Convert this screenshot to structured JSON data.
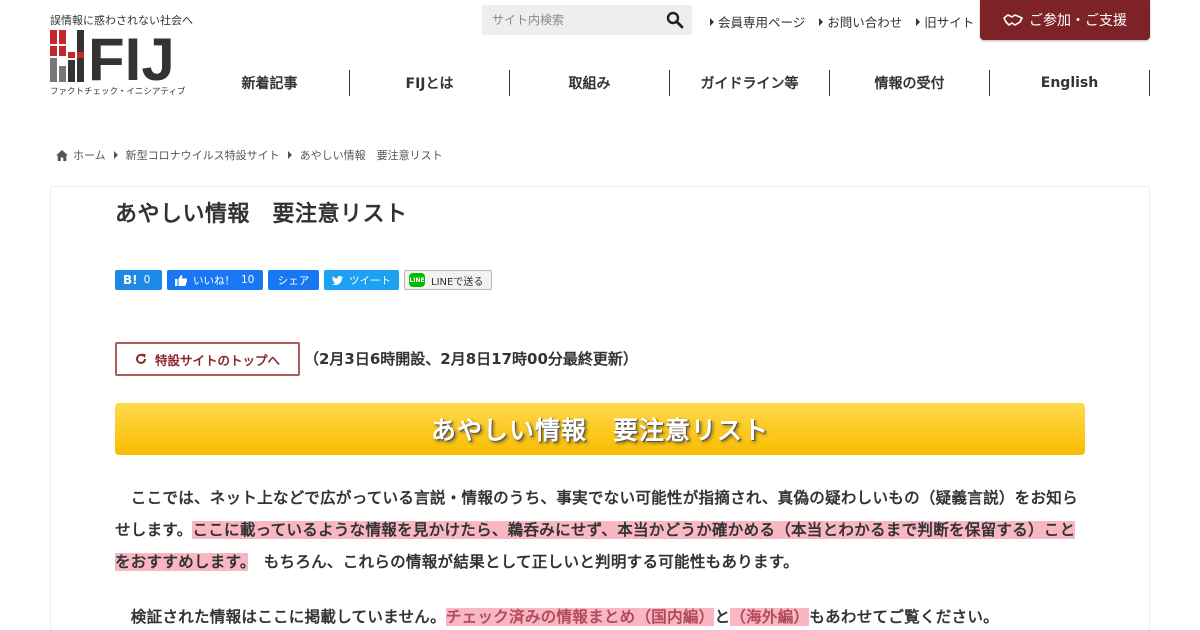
{
  "header": {
    "tagline": "誤情報に惑わされない社会へ",
    "logo_text": "FIJ",
    "logo_sub": "ファクトチェック・イニシアティブ",
    "search_placeholder": "サイト内検索",
    "top_links": [
      "会員専用ページ",
      "お問い合わせ",
      "旧サイト"
    ],
    "join_label": "ご参加・ご支援",
    "accent": "#7d2327"
  },
  "nav": {
    "items": [
      "新着記事",
      "FIJとは",
      "取組み",
      "ガイドライン等",
      "情報の受付",
      "English"
    ]
  },
  "breadcrumb": {
    "home": "ホーム",
    "parent": "新型コロナウイルス特設サイト",
    "current": "あやしい情報　要注意リスト"
  },
  "article": {
    "title": "あやしい情報　要注意リスト",
    "share": {
      "hatena_count": "0",
      "like_label": "いいね！",
      "like_count": "10",
      "share_label": "シェア",
      "tweet_label": "ツイート",
      "line_label": "LINEで送る"
    },
    "top_button_label": "特設サイトのトップへ",
    "update_text": "（2月3日6時開設、2月8日17時00分最終更新）",
    "banner_title": "あやしい情報　要注意リスト",
    "banner_color": "#f8bd00",
    "p1_a": "　ここでは、ネット上などで広がっている言説・情報のうち、事実でない可能性が指摘され、真偽の疑わしいもの（疑義言説）をお知らせします。",
    "p1_highlight": "ここに載っているような情報を見かけたら、鵜呑みにせず、本当かどうか確かめる（本当とわかるまで判断を保留する）ことをおすすめします。",
    "p1_b": "もちろん、これらの情報が結果として正しいと判明する可能性もあります。",
    "p2_a": "　検証された情報はここに掲載していません。",
    "p2_link1": "チェック済みの情報まとめ（国内編）",
    "p2_mid": "と",
    "p2_link2": "（海外編）",
    "p2_b": "もあわせてご覧ください。"
  }
}
